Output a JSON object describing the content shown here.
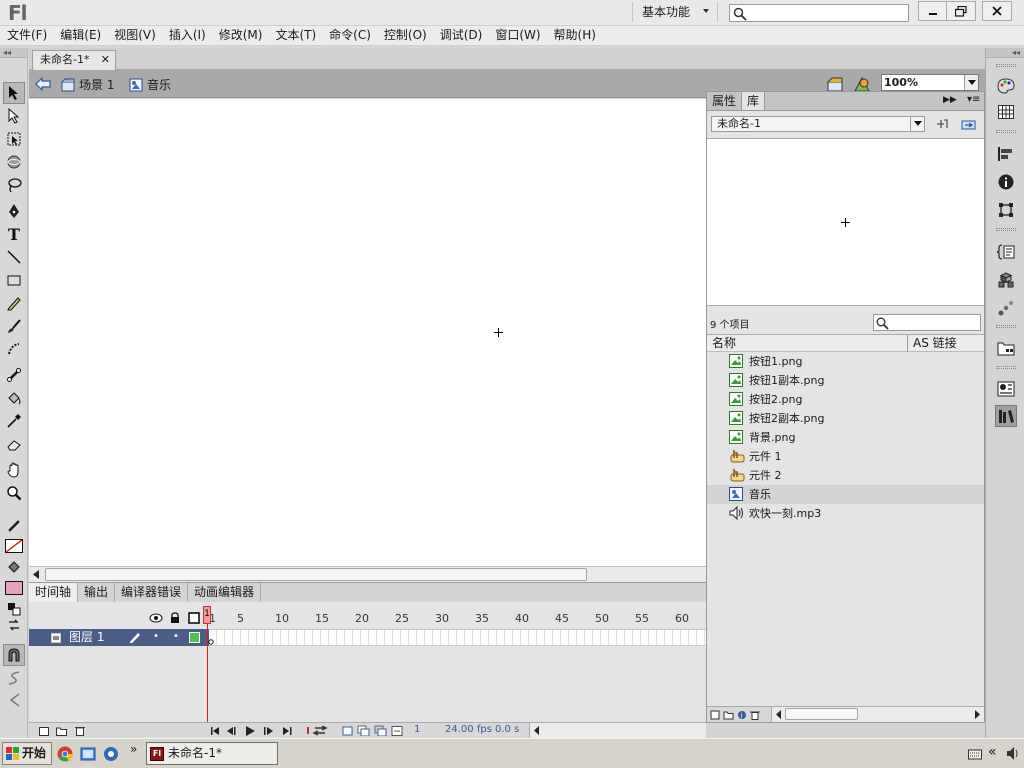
{
  "app": {
    "logo": "Fl",
    "workspace": "基本功能"
  },
  "menu": [
    "文件(F)",
    "编辑(E)",
    "视图(V)",
    "插入(I)",
    "修改(M)",
    "文本(T)",
    "命令(C)",
    "控制(O)",
    "调试(D)",
    "窗口(W)",
    "帮助(H)"
  ],
  "document": {
    "tab_title": "未命名-1*"
  },
  "editbar": {
    "scene": "场景 1",
    "symbol": "音乐",
    "zoom": "100%"
  },
  "timeline": {
    "tabs": [
      "时间轴",
      "输出",
      "编译器错误",
      "动画编辑器"
    ],
    "ruler": [
      "1",
      "5",
      "10",
      "15",
      "20",
      "25",
      "30",
      "35",
      "40",
      "45",
      "50",
      "55",
      "60"
    ],
    "layer_name": "图层 1",
    "current_frame": "1",
    "fps": "24.00",
    "fps_unit": "fps",
    "time": "0.0 s"
  },
  "library": {
    "tabs": [
      "属性",
      "库"
    ],
    "document": "未命名-1",
    "item_count": "9 个项目",
    "col_name": "名称",
    "col_link": "AS 链接",
    "items": [
      {
        "name": "按钮1.png",
        "type": "bitmap-icon"
      },
      {
        "name": "按钮1副本.png",
        "type": "bitmap-icon"
      },
      {
        "name": "按钮2.png",
        "type": "bitmap-icon"
      },
      {
        "name": "按钮2副本.png",
        "type": "bitmap-icon"
      },
      {
        "name": "背景.png",
        "type": "bitmap-icon"
      },
      {
        "name": "元件 1",
        "type": "button-symbol-icon"
      },
      {
        "name": "元件 2",
        "type": "button-symbol-icon"
      },
      {
        "name": "音乐",
        "type": "graphic-symbol-icon"
      },
      {
        "name": "欢快一刻.mp3",
        "type": "sound-icon"
      }
    ],
    "selected_index": 7
  },
  "taskbar": {
    "start": "开始",
    "task": "未命名-1*"
  },
  "colors": {
    "layer_selected": "#4b5e87",
    "playhead": "#d02020",
    "fill_swatch": "#e8a0c0"
  }
}
